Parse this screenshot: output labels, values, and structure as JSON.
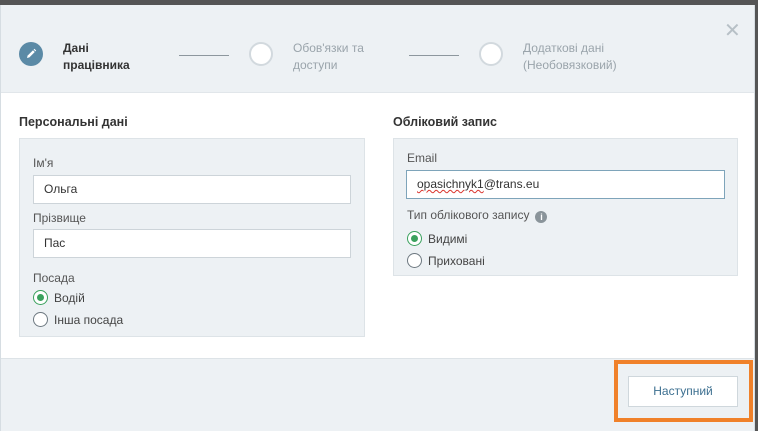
{
  "stepper": {
    "steps": [
      {
        "label": "Дані\nпрацівника",
        "state": "active"
      },
      {
        "label": "Обов'язки та\nдоступи",
        "state": "pending"
      },
      {
        "label": "Додаткові дані\n(Необовязковий)",
        "state": "pending"
      }
    ],
    "close_icon": "close-icon",
    "close_glyph": "✕"
  },
  "personal": {
    "title": "Персональні дані",
    "first_name_label": "Ім'я",
    "first_name_value": "Ольга",
    "last_name_label": "Прізвище",
    "last_name_value": "Пас",
    "position_label": "Посада",
    "positions": [
      {
        "label": "Водій",
        "checked": true
      },
      {
        "label": "Інша посада",
        "checked": false
      }
    ]
  },
  "account": {
    "title": "Обліковий запис",
    "email_label": "Email",
    "email_value_misspelled": "opasichnyk1",
    "email_value_rest": "@trans.eu",
    "type_label": "Тип облікового запису",
    "info_glyph": "i",
    "types": [
      {
        "label": "Видимі",
        "checked": true
      },
      {
        "label": "Приховані",
        "checked": false
      }
    ]
  },
  "footer": {
    "next_label": "Наступний"
  },
  "colors": {
    "accent": "#5b8aa6",
    "radio_checked": "#3aa15d",
    "highlight": "#f0812a"
  }
}
